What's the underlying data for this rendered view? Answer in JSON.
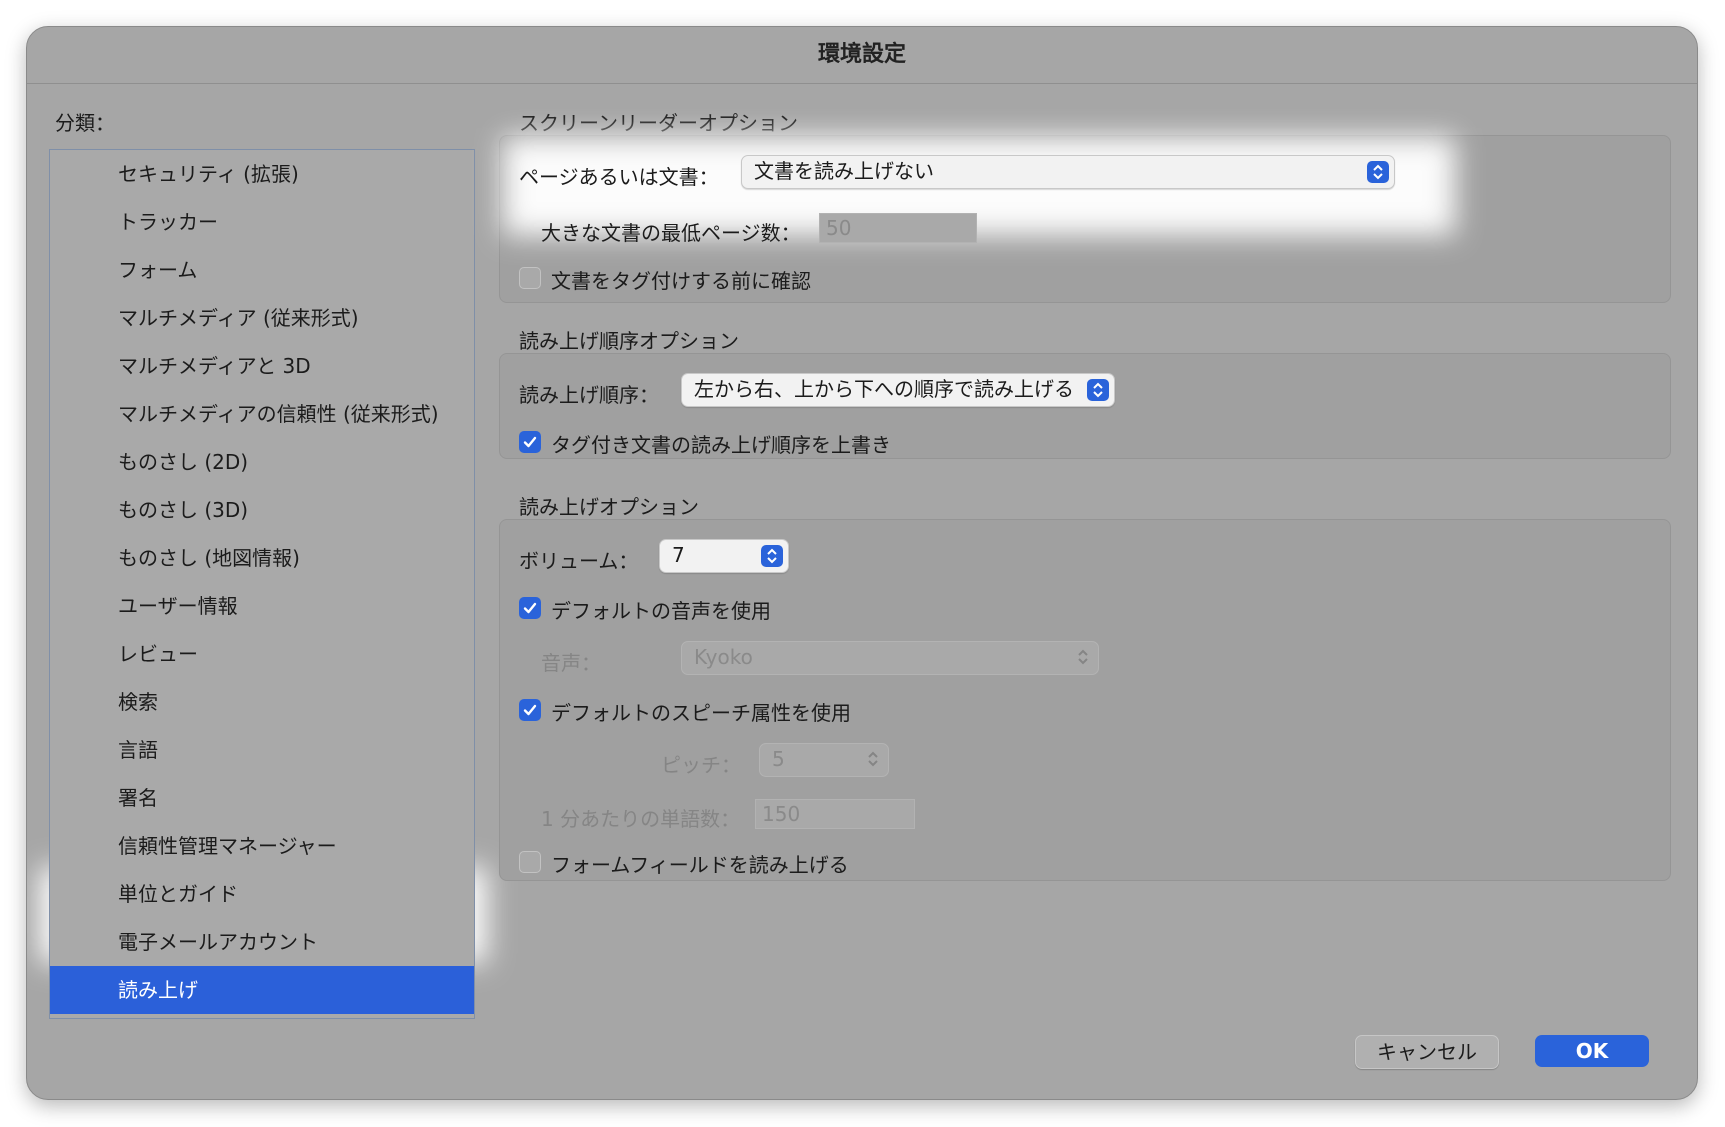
{
  "window": {
    "title": "環境設定"
  },
  "sidebar": {
    "label": "分類：",
    "items": [
      "セキュリティ (拡張)",
      "トラッカー",
      "フォーム",
      "マルチメディア (従来形式)",
      "マルチメディアと 3D",
      "マルチメディアの信頼性 (従来形式)",
      "ものさし (2D)",
      "ものさし (3D)",
      "ものさし (地図情報)",
      "ユーザー情報",
      "レビュー",
      "検索",
      "言語",
      "署名",
      "信頼性管理マネージャー",
      "単位とガイド",
      "電子メールアカウント",
      "読み上げ"
    ],
    "selected": "読み上げ"
  },
  "screen_reader": {
    "title": "スクリーンリーダーオプション",
    "page_or_doc_label": "ページあるいは文書：",
    "page_or_doc_value": "文書を読み上げない",
    "min_pages_label": "大きな文書の最低ページ数：",
    "min_pages_value": "50",
    "confirm_tagging_label": "文書をタグ付けする前に確認",
    "confirm_tagging_checked": false
  },
  "reading_order": {
    "title": "読み上げ順序オプション",
    "order_label": "読み上げ順序：",
    "order_value": "左から右、上から下への順序で読み上げる",
    "override_label": "タグ付き文書の読み上げ順序を上書き",
    "override_checked": true
  },
  "read_out": {
    "title": "読み上げオプション",
    "volume_label": "ボリューム：",
    "volume_value": "7",
    "default_voice_label": "デフォルトの音声を使用",
    "default_voice_checked": true,
    "voice_label": "音声：",
    "voice_value": "Kyoko",
    "default_speech_label": "デフォルトのスピーチ属性を使用",
    "default_speech_checked": true,
    "pitch_label": "ピッチ：",
    "pitch_value": "5",
    "wpm_label": "1 分あたりの単語数：",
    "wpm_value": "150",
    "form_fields_label": "フォームフィールドを読み上げる",
    "form_fields_checked": false
  },
  "buttons": {
    "cancel": "キャンセル",
    "ok": "OK"
  },
  "colors": {
    "accent": "#2a63da",
    "window_bg": "#a6a6a6"
  }
}
